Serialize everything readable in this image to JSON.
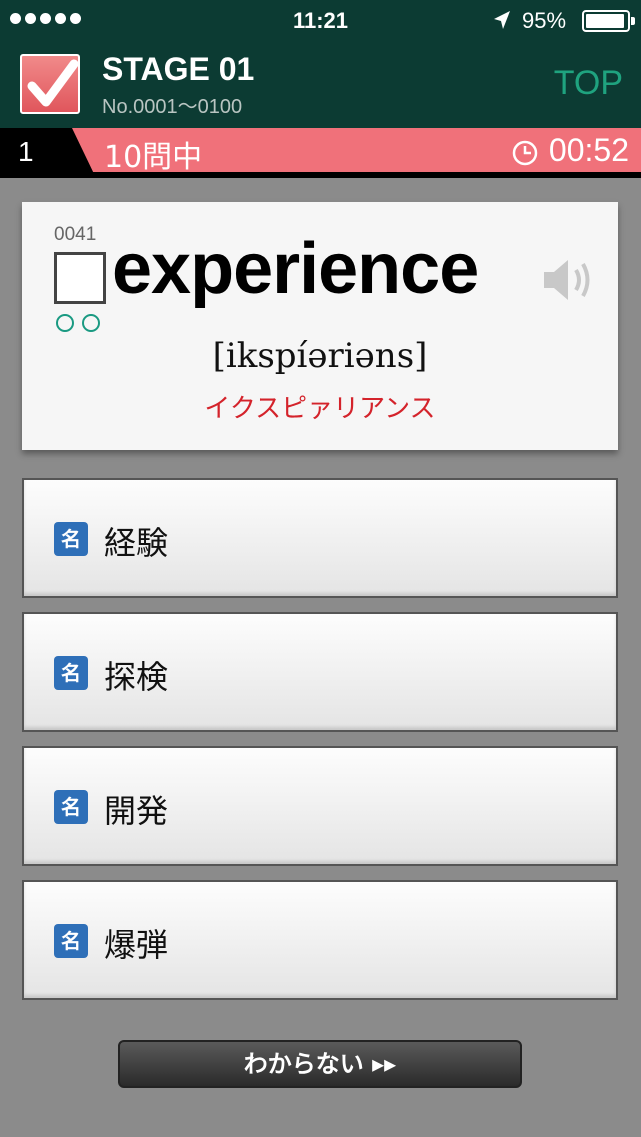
{
  "status_bar": {
    "time": "11:21",
    "battery_percent": "95%",
    "signal_dots": 5
  },
  "header": {
    "stage_title": "STAGE 01",
    "stage_range": "No.0001～0100",
    "top_link": "TOP"
  },
  "progress": {
    "question_number": "1",
    "total_label": "10問中",
    "timer": "00:52"
  },
  "word_card": {
    "word_id": "0041",
    "word": "experience",
    "phonetic": "[ikspíəriəns]",
    "katakana": "イクスピァリアンス"
  },
  "answers": [
    {
      "pos": "名",
      "text": "経験"
    },
    {
      "pos": "名",
      "text": "探検"
    },
    {
      "pos": "名",
      "text": "開発"
    },
    {
      "pos": "名",
      "text": "爆弾"
    }
  ],
  "dont_know_label": "わからない ▸▸",
  "colors": {
    "header_bg": "#0c3b33",
    "progress_bar": "#f0717a",
    "accent_green": "#1fa37f",
    "pos_badge": "#2e6fb8",
    "katakana_red": "#d4232b"
  }
}
